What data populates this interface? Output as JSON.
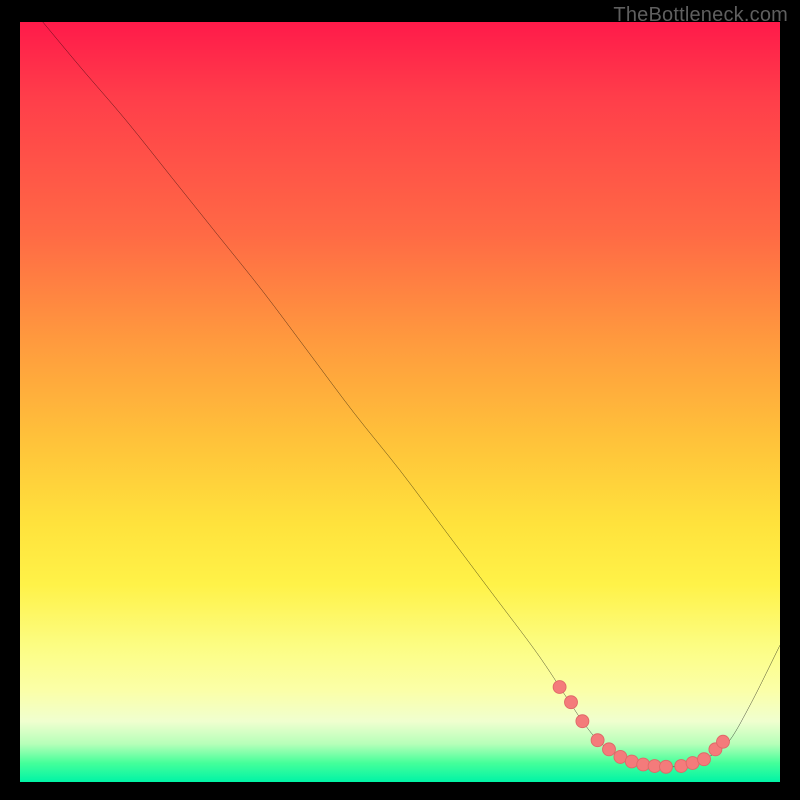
{
  "watermark": "TheBottleneck.com",
  "chart_data": {
    "type": "line",
    "title": "",
    "xlabel": "",
    "ylabel": "",
    "xlim": [
      0,
      100
    ],
    "ylim": [
      0,
      100
    ],
    "grid": false,
    "legend": false,
    "series": [
      {
        "name": "bottleneck-curve",
        "x": [
          3,
          8,
          14,
          20,
          26,
          32,
          38,
          44,
          50,
          56,
          62,
          68,
          72,
          74,
          76,
          78,
          80,
          82,
          84,
          86,
          88,
          90,
          93,
          96,
          100
        ],
        "y": [
          100,
          94,
          87,
          79.5,
          72,
          64.5,
          56.5,
          48.5,
          41,
          33,
          25,
          17,
          11,
          8,
          5.5,
          4,
          3,
          2.3,
          2,
          2,
          2.2,
          3,
          5,
          10,
          18
        ]
      }
    ],
    "markers": {
      "name": "highlighted-points",
      "x": [
        71,
        72.5,
        74,
        76,
        77.5,
        79,
        80.5,
        82,
        83.5,
        85,
        87,
        88.5,
        90,
        91.5,
        92.5
      ],
      "y": [
        12.5,
        10.5,
        8,
        5.5,
        4.3,
        3.3,
        2.7,
        2.3,
        2.1,
        2,
        2.1,
        2.5,
        3,
        4.3,
        5.3
      ]
    },
    "gradient_stops": [
      {
        "pct": 0,
        "color": "#ff1a4a"
      },
      {
        "pct": 10,
        "color": "#ff3e4a"
      },
      {
        "pct": 28,
        "color": "#ff6a45"
      },
      {
        "pct": 42,
        "color": "#ff9a3e"
      },
      {
        "pct": 55,
        "color": "#ffc23a"
      },
      {
        "pct": 66,
        "color": "#ffe23c"
      },
      {
        "pct": 74,
        "color": "#fff248"
      },
      {
        "pct": 82,
        "color": "#fcfd82"
      },
      {
        "pct": 88,
        "color": "#fbffa8"
      },
      {
        "pct": 92,
        "color": "#f0ffcf"
      },
      {
        "pct": 95,
        "color": "#b6ffb9"
      },
      {
        "pct": 97.5,
        "color": "#45ff9a"
      },
      {
        "pct": 100,
        "color": "#00f4a6"
      }
    ],
    "colors": {
      "curve": "#000000",
      "marker_fill": "#f47b7b",
      "marker_stroke": "#e06868",
      "background_frame": "#000000"
    }
  }
}
